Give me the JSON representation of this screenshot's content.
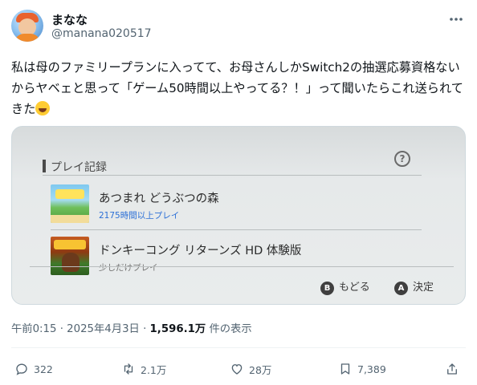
{
  "post": {
    "author_name": "まなな",
    "author_handle": "@manana020517",
    "more_icon": "more-horizontal-icon",
    "text": "私は母のファミリープランに入ってて、お母さんしかSwitch2の抽選応募資格ないからヤベェと思って「ゲーム50時間以上やってる？！」って聞いたらこれ送られてきた",
    "emoji": "rolling-on-floor-laughing-emoji"
  },
  "media": {
    "section_title": "プレイ記録",
    "help_glyph": "?",
    "games": [
      {
        "title": "あつまれ どうぶつの森",
        "playtime": "2175時間以上プレイ",
        "thumbnail": "animal-crossing-thumbnail"
      },
      {
        "title": "ドンキーコング リターンズ HD 体験版",
        "playtime": "少しだけプレイ",
        "thumbnail": "donkey-kong-thumbnail"
      }
    ],
    "footer": {
      "back_key": "B",
      "back_label": "もどる",
      "confirm_key": "A",
      "confirm_label": "決定"
    }
  },
  "meta": {
    "time": "午前0:15",
    "date": "2025年4月3日",
    "dot": "·",
    "views_count": "1,596.1万",
    "views_suffix": "件の表示"
  },
  "actions": {
    "reply_count": "322",
    "repost_count": "2.1万",
    "like_count": "28万",
    "bookmark_count": "7,389"
  },
  "colors": {
    "text_primary": "#0f1419",
    "text_secondary": "#536471",
    "playtime_blue": "#2b6fd6"
  }
}
